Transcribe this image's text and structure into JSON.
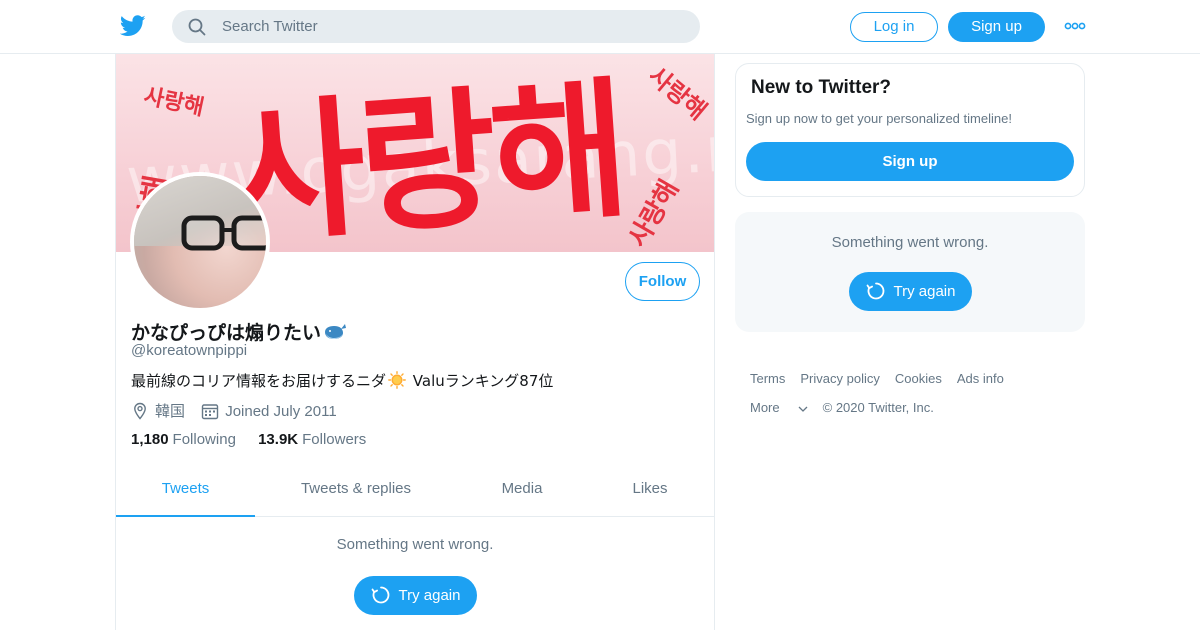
{
  "header": {
    "search_placeholder": "Search Twitter",
    "login_label": "Log in",
    "signup_label": "Sign up"
  },
  "banner": {
    "big_text": "사랑해",
    "small_text": "사랑해",
    "watermark": "www.ogaksarang.net"
  },
  "profile": {
    "name": "かなぴっぴは煽りたい",
    "handle": "@koreatownpippi",
    "bio_before": "最前線のコリア情報をお届けするニダ",
    "bio_after": " Valuランキング87位",
    "location": "韓国",
    "joined": "Joined July 2011",
    "following_count": "1,180",
    "following_label": "Following",
    "followers_count": "13.9K",
    "followers_label": "Followers",
    "follow_label": "Follow"
  },
  "tabs": [
    {
      "label": "Tweets",
      "active": true
    },
    {
      "label": "Tweets & replies",
      "active": false
    },
    {
      "label": "Media",
      "active": false
    },
    {
      "label": "Likes",
      "active": false
    }
  ],
  "timeline": {
    "error": "Something went wrong.",
    "retry_label": "Try again"
  },
  "sidebar": {
    "signup_title": "New to Twitter?",
    "signup_sub": "Sign up now to get your personalized timeline!",
    "signup_button": "Sign up",
    "error": "Something went wrong.",
    "retry_label": "Try again"
  },
  "footer": {
    "links": [
      "Terms",
      "Privacy policy",
      "Cookies",
      "Ads info"
    ],
    "more": "More",
    "copyright": "© 2020 Twitter, Inc."
  },
  "colors": {
    "accent": "#1da1f2",
    "muted": "#657786",
    "border": "#e6ecf0",
    "banner_red": "#ee1a2c"
  }
}
